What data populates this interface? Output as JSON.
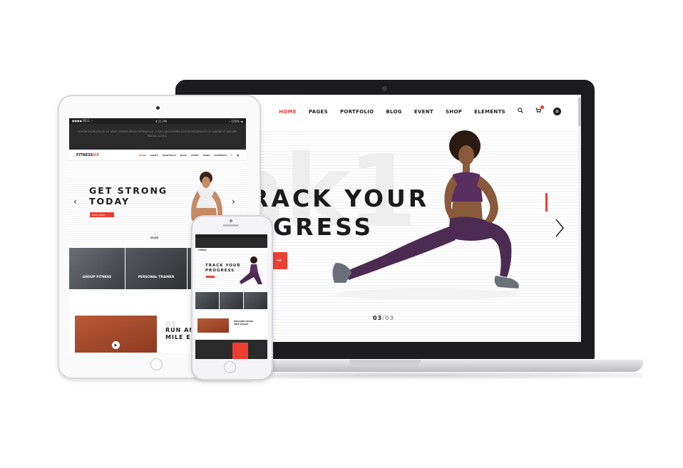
{
  "colors": {
    "accent": "#ee3e31",
    "dark": "#1b1b1b"
  },
  "laptop": {
    "nav": {
      "items": [
        "HOME",
        "PAGES",
        "PORTFOLIO",
        "BLOG",
        "EVENT",
        "SHOP",
        "ELEMENTS"
      ],
      "active": "HOME",
      "icons": [
        "search-icon",
        "cart-icon",
        "menu-icon"
      ]
    },
    "hero": {
      "watermark": "ak1",
      "title_line1": "RACK YOUR",
      "title_line2": "OGRESS",
      "button_icon": "→",
      "counter_current": "03",
      "counter_sep": "/",
      "counter_total": "03",
      "next_icon": "chevron-right-icon"
    }
  },
  "tablet": {
    "status": {
      "carrier": "●●●● BELL ⌔",
      "time": "4:21 PM",
      "battery": "⌁ 100% ▬"
    },
    "topbar_text": "LOREM IPSUM DOLOR SIT AMET, DOBED EEFAX OPTIMABILID. TI DEC ED ESOMIRG EASTES INCIDIBLETE UT LABORE ET DOLORE MAGNA ALIQUA.",
    "logo_main": "FITNESS",
    "logo_accent": "ICE",
    "menu": [
      "HOME",
      "PAGES",
      "PORTFOLIO",
      "BLOG",
      "EVENT",
      "SHOP",
      "ELEMENTS"
    ],
    "hero": {
      "title_line1": "GET STRONG",
      "title_line2": "TODAY",
      "button_label": "READ MORE",
      "counter": "01/03"
    },
    "tiles": [
      "GROUP FITNESS",
      "PERSONAL TRAINER",
      ""
    ],
    "feature": {
      "number": "01",
      "title": "RUN AN EXT\nMILE EASIL"
    }
  },
  "phone": {
    "nav_logo": "FITNESS",
    "hero": {
      "title_line1": "TRACK YOUR",
      "title_line2": "PROGRESS"
    },
    "feature": {
      "title": "EXPLORE EXTRA\nMILE EASILY"
    }
  }
}
